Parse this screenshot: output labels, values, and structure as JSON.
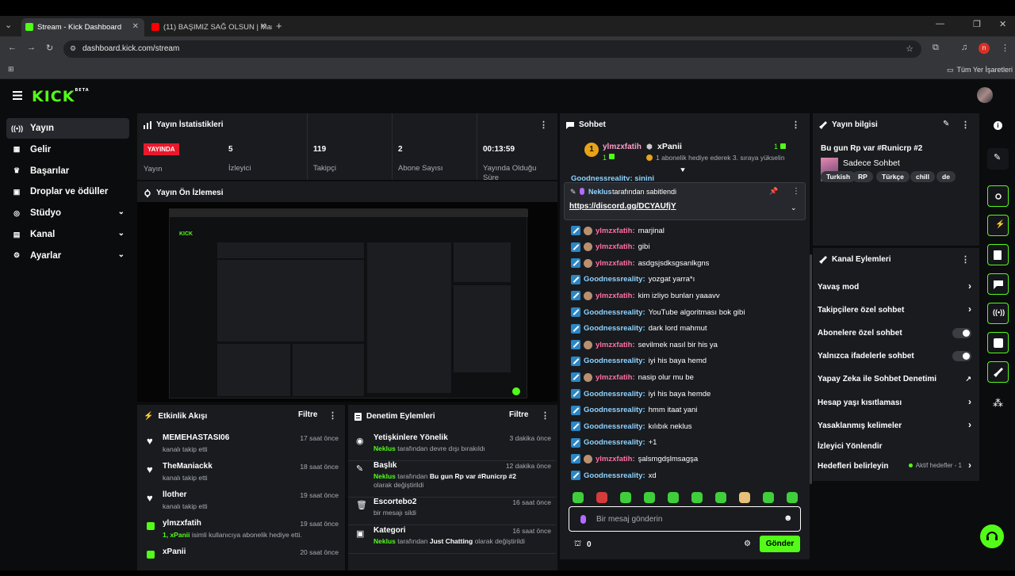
{
  "browser": {
    "tabs": [
      {
        "title": "Stream - Kick Dashboard",
        "active": true
      },
      {
        "title": "(11) BAŞIMIZ SAĞ OLSUN | Mar",
        "active": false
      }
    ],
    "url": "dashboard.kick.com/stream",
    "bookmarks_label": "Tüm Yer İşaretleri",
    "profile_initial": "n"
  },
  "logo": {
    "text": "KICK",
    "beta": "BETA"
  },
  "sidebar": {
    "items": [
      {
        "label": "Yayın",
        "icon": "broadcast-icon",
        "active": true
      },
      {
        "label": "Gelir",
        "icon": "revenue-icon"
      },
      {
        "label": "Başarılar",
        "icon": "trophy-icon"
      },
      {
        "label": "Droplar ve ödüller",
        "icon": "gift-icon"
      },
      {
        "label": "Stüdyo",
        "icon": "studio-icon",
        "expandable": true
      },
      {
        "label": "Kanal",
        "icon": "channel-icon",
        "expandable": true
      },
      {
        "label": "Ayarlar",
        "icon": "settings-icon",
        "expandable": true
      }
    ]
  },
  "stats": {
    "title": "Yayın İstatistikleri",
    "live_badge": "YAYINDA",
    "live_label": "Yayın",
    "items": [
      {
        "value": "5",
        "label": "İzleyici"
      },
      {
        "value": "119",
        "label": "Takipçi"
      },
      {
        "value": "2",
        "label": "Abone Sayısı"
      },
      {
        "value": "00:13:59",
        "label": "Yayında Olduğu Süre"
      }
    ]
  },
  "preview": {
    "title": "Yayın Ön İzlemesi"
  },
  "activity": {
    "title": "Etkinlik Akışı",
    "filter": "Filtre",
    "items": [
      {
        "name": "MEMEHASTASI06",
        "sub": "kanalı takip etti",
        "time": "17 saat önce",
        "icon": "heart-icon"
      },
      {
        "name": "TheManiackk",
        "sub": "kanalı takip etti",
        "time": "18 saat önce",
        "icon": "heart-icon"
      },
      {
        "name": "llother",
        "sub": "kanalı takip etti",
        "time": "19 saat önce",
        "icon": "heart-icon"
      },
      {
        "name": "ylmzxfatih",
        "sub_prefix": "1, ",
        "sub_highlight": "xPanii",
        "sub": " isimli kullanıcıya abonelik hediye etti.",
        "time": "19 saat önce",
        "icon": "gift-icon"
      },
      {
        "name": "xPanii",
        "sub": "",
        "time": "20 saat önce",
        "icon": "gift-icon"
      }
    ]
  },
  "moderation": {
    "title": "Denetim Eylemleri",
    "filter": "Filtre",
    "items": [
      {
        "name": "Yetişkinlere Yönelik",
        "actor": "Neklus",
        "text": " tarafından devre dışı bırakıldı",
        "time": "3 dakika önce",
        "icon": "eye-icon"
      },
      {
        "name": "Başlık",
        "actor": "Neklus",
        "text": " tarafından ",
        "value": "Bu gun Rp var #Runicrp #2",
        "text2": " olarak değiştirildi",
        "time": "12 dakika önce",
        "icon": "title-icon"
      },
      {
        "name": "Escortebo2",
        "actor": "",
        "text": "bir mesajı sildi",
        "time": "16 saat önce",
        "icon": "trash-icon"
      },
      {
        "name": "Kategori",
        "actor": "Neklus",
        "text": " tarafından ",
        "value": "Just Chatting",
        "text2": " olarak değiştirildi",
        "time": "16 saat önce",
        "icon": "category-icon"
      }
    ]
  },
  "chat": {
    "title": "Sohbet",
    "gift_banner": {
      "gifter": "ylmzxfatih",
      "gifter_count": "1",
      "recipient": "xPanii",
      "count": "1",
      "text": "1 abonelik hediye ederek 3. sıraya yükselin"
    },
    "pinned": {
      "by": "Neklus",
      "by_suffix": " tarafından sabitlendi",
      "link": "https://discord.gg/DCYAUfjY"
    },
    "partial_msg": "Goodnessreality: sinini",
    "messages": [
      {
        "user": "ylmzxfatih",
        "type": "y",
        "text": "marjinal"
      },
      {
        "user": "ylmzxfatih",
        "type": "y",
        "text": "gibi"
      },
      {
        "user": "ylmzxfatih",
        "type": "y",
        "text": "asdgsjsdksgsanlkgns"
      },
      {
        "user": "Goodnessreality",
        "type": "g",
        "text": "yozgat yarra*ı"
      },
      {
        "user": "ylmzxfatih",
        "type": "y",
        "text": "kim izliyo bunları yaaavv"
      },
      {
        "user": "Goodnessreality",
        "type": "g",
        "text": "YouTube algoritması bok gibi"
      },
      {
        "user": "Goodnessreality",
        "type": "g",
        "text": "dark lord mahmut"
      },
      {
        "user": "ylmzxfatih",
        "type": "y",
        "text": "sevilmek nasıl bir his ya"
      },
      {
        "user": "Goodnessreality",
        "type": "g",
        "text": "iyi his baya hemd"
      },
      {
        "user": "ylmzxfatih",
        "type": "y",
        "text": "nasip olur mu be"
      },
      {
        "user": "Goodnessreality",
        "type": "g",
        "text": "iyi his baya hemde"
      },
      {
        "user": "Goodnessreality",
        "type": "g",
        "text": "hmm itaat yani"
      },
      {
        "user": "Goodnessreality",
        "type": "g",
        "text": "kılıbık neklus"
      },
      {
        "user": "Goodnessreality",
        "type": "g",
        "text": "+1"
      },
      {
        "user": "ylmzxfatih",
        "type": "y",
        "text": "şalsmgdşlmsagşa"
      },
      {
        "user": "Goodnessreality",
        "type": "g",
        "text": "xd"
      }
    ],
    "input_placeholder": "Bir mesaj gönderin",
    "viewer_count": "0",
    "send_label": "Gönder"
  },
  "stream_info": {
    "title": "Yayın bilgisi",
    "stream_title": "Bu gun Rp var #Runicrp #2",
    "category": "Sadece Sohbet",
    "tags": [
      "Turkish",
      "RP",
      "Türkçe",
      "chill",
      "de"
    ]
  },
  "channel_actions": {
    "title": "Kanal Eylemleri",
    "items": [
      {
        "label": "Yavaş mod",
        "control": "arrow"
      },
      {
        "label": "Takipçilere özel sohbet",
        "control": "arrow"
      },
      {
        "label": "Abonelere özel sohbet",
        "control": "toggle"
      },
      {
        "label": "Yalnızca ifadelerle sohbet",
        "control": "toggle"
      },
      {
        "label": "Yapay Zeka ile Sohbet Denetimi",
        "control": "external"
      },
      {
        "label": "Hesap yaşı kısıtlaması",
        "control": "arrow"
      },
      {
        "label": "Yasaklanmış kelimeler",
        "control": "arrow"
      },
      {
        "label": "İzleyici Yönlendir",
        "control": "none"
      },
      {
        "label": "Hedefleri belirleyin",
        "control": "arrow",
        "extra": "Aktif hedefler - 1"
      }
    ]
  },
  "colors": {
    "brand": "#53fc18",
    "live": "#e8192c",
    "panel": "#191b1f",
    "bg": "#0b0c0d"
  }
}
